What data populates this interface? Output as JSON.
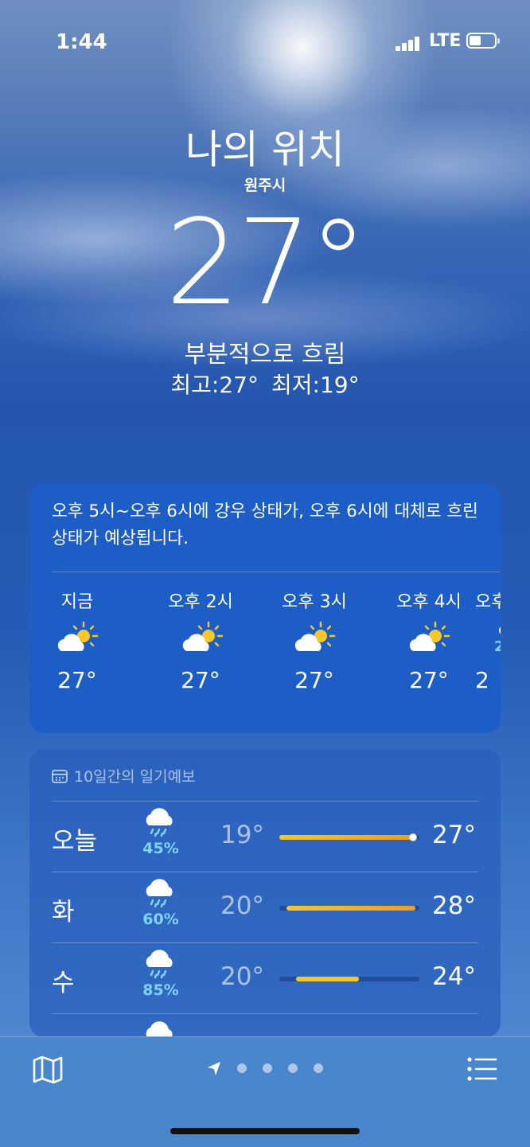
{
  "status": {
    "time": "1:44",
    "network": "LTE"
  },
  "header": {
    "location": "나의 위치",
    "city": "원주시",
    "temp": "27°",
    "condition": "부분적으로 흐림",
    "high": "최고:27°",
    "low": "최저:19°"
  },
  "hourly": {
    "summary": "오후 5시~오후 6시에 강우 상태가, 오후 6시에 대체로 흐린 상태가 예상됩니다.",
    "items": [
      {
        "label": "지금",
        "icon": "partly-cloudy-icon",
        "temp": "27°"
      },
      {
        "label": "오후 2시",
        "icon": "partly-cloudy-icon",
        "temp": "27°"
      },
      {
        "label": "오후 3시",
        "icon": "partly-cloudy-icon",
        "temp": "27°"
      },
      {
        "label": "오후 4시",
        "icon": "partly-cloudy-icon",
        "temp": "27°"
      },
      {
        "label": "오후",
        "icon": "rain-icon",
        "temp": "2"
      }
    ],
    "partial_pct": "2"
  },
  "forecast": {
    "title": "10일간의 일기예보",
    "days": [
      {
        "day": "오늘",
        "icon": "rain-cloud-icon",
        "pct": "45%",
        "low": "19°",
        "high": "27°",
        "range_start": 0.0,
        "range_end": 0.95,
        "current": 0.95
      },
      {
        "day": "화",
        "icon": "rain-cloud-icon",
        "pct": "60%",
        "low": "20°",
        "high": "28°",
        "range_start": 0.05,
        "range_end": 0.97
      },
      {
        "day": "수",
        "icon": "rain-cloud-icon",
        "pct": "85%",
        "low": "20°",
        "high": "24°",
        "range_start": 0.12,
        "range_end": 0.57
      }
    ]
  },
  "colors": {
    "rain_pct": "#7fd4ff",
    "range_low": "#f6c729",
    "range_high": "#f39c1d"
  }
}
